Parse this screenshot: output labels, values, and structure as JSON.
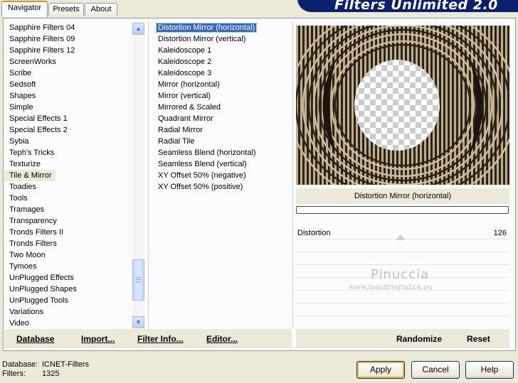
{
  "header": {
    "title": "Filters Unlimited 2.0"
  },
  "tabs": [
    {
      "label": "Navigator"
    },
    {
      "label": "Presets"
    },
    {
      "label": "About"
    }
  ],
  "categories": [
    "Sapphire Filters 04",
    "Sapphire Filters 09",
    "Sapphire Filters 12",
    "ScreenWorks",
    "Scribe",
    "Sedsoft",
    "Shapes",
    "Simple",
    "Special Effects 1",
    "Special Effects 2",
    "Sybia",
    "Teph's Tricks",
    "Texturize",
    "Tile & Mirror",
    "Toadies",
    "Tools",
    "Tramages",
    "Transparency",
    "Tronds Filters II",
    "Tronds Filters",
    "Two Moon",
    "Tymoes",
    "UnPlugged Effects",
    "UnPlugged Shapes",
    "UnPlugged Tools",
    "Variations",
    "Video"
  ],
  "selected_category": "Tile & Mirror",
  "filters": [
    "Distortion Mirror (horizontal)",
    "Distortion Mirror (vertical)",
    "Kaleidoscope 1",
    "Kaleidoscope 2",
    "Kaleidoscope 3",
    "Mirror (horizontal)",
    "Mirror (vertical)",
    "Mirrored & Scaled",
    "Quadrant Mirror",
    "Radial Mirror",
    "Radial Tile",
    "Seamless Blend (horizontal)",
    "Seamless Blend (vertical)",
    "XY Offset 50% (negative)",
    "XY Offset 50% (positive)"
  ],
  "selected_filter": "Distortion Mirror (horizontal)",
  "links": {
    "database": "Database",
    "import": "Import...",
    "filter_info": "Filter Info...",
    "editor": "Editor...",
    "randomize": "Randomize",
    "reset": "Reset"
  },
  "preview": {
    "filter_name": "Distortion Mirror (horizontal)"
  },
  "params": [
    {
      "label": "Distortion",
      "value": "126"
    }
  ],
  "watermark": {
    "name": "Pinuccia",
    "url": "www.maidiregrafica.eu"
  },
  "status": {
    "database_label": "Database:",
    "database_value": "ICNET-Filters",
    "filters_label": "Filters:",
    "filters_value": "1325"
  },
  "buttons": {
    "apply": "Apply",
    "cancel": "Cancel",
    "help": "Help"
  },
  "colors": {
    "selection": "#316ac5",
    "banner": "#0a1f6e",
    "accent_tab": "#e68b2c"
  }
}
